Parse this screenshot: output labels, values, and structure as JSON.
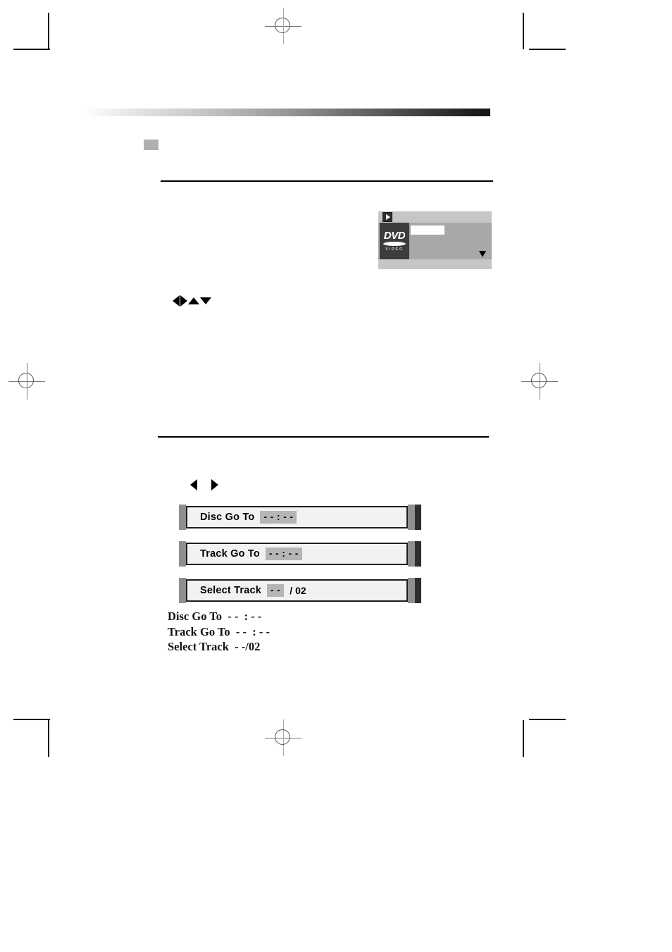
{
  "page": {
    "background_color": "#ffffff",
    "header_band": {
      "name": "gradient-rule",
      "gradient_from": "#ffffff",
      "gradient_to": "#141414"
    },
    "marker_square_color": "#b0b0b0"
  },
  "osd": {
    "play_icon": "play-icon",
    "disc_logo": {
      "word": "DVD",
      "subtext": "VIDEO"
    },
    "field_value": "",
    "caret_icon": "triangle-down-icon",
    "panel_color": "#a8a8a8",
    "frame_color": "#c6c6c6",
    "tile_color": "#3c3c3c"
  },
  "arrow_rows": {
    "navigation": [
      {
        "icon": "arrow-left-icon",
        "dir": "left"
      },
      {
        "icon": "arrow-right-icon",
        "dir": "right"
      },
      {
        "icon": "arrow-up-icon",
        "dir": "up"
      },
      {
        "icon": "arrow-down-icon",
        "dir": "down"
      }
    ],
    "left_right": [
      {
        "icon": "arrow-left-icon",
        "dir": "left"
      },
      {
        "icon": "arrow-right-icon",
        "dir": "right"
      }
    ]
  },
  "menu_bars": [
    {
      "name": "disc-go-to",
      "label": "Disc Go To",
      "value": "- - : - -",
      "suffix": ""
    },
    {
      "name": "track-go-to",
      "label": "Track Go To",
      "value": "- - : - -",
      "suffix": ""
    },
    {
      "name": "select-track",
      "label": "Select Track",
      "value": "- -",
      "suffix": "/ 02"
    }
  ],
  "captions": [
    "Disc Go To  - -  : - -",
    "Track Go To  - -  : - -",
    "Select Track  - -/02"
  ]
}
